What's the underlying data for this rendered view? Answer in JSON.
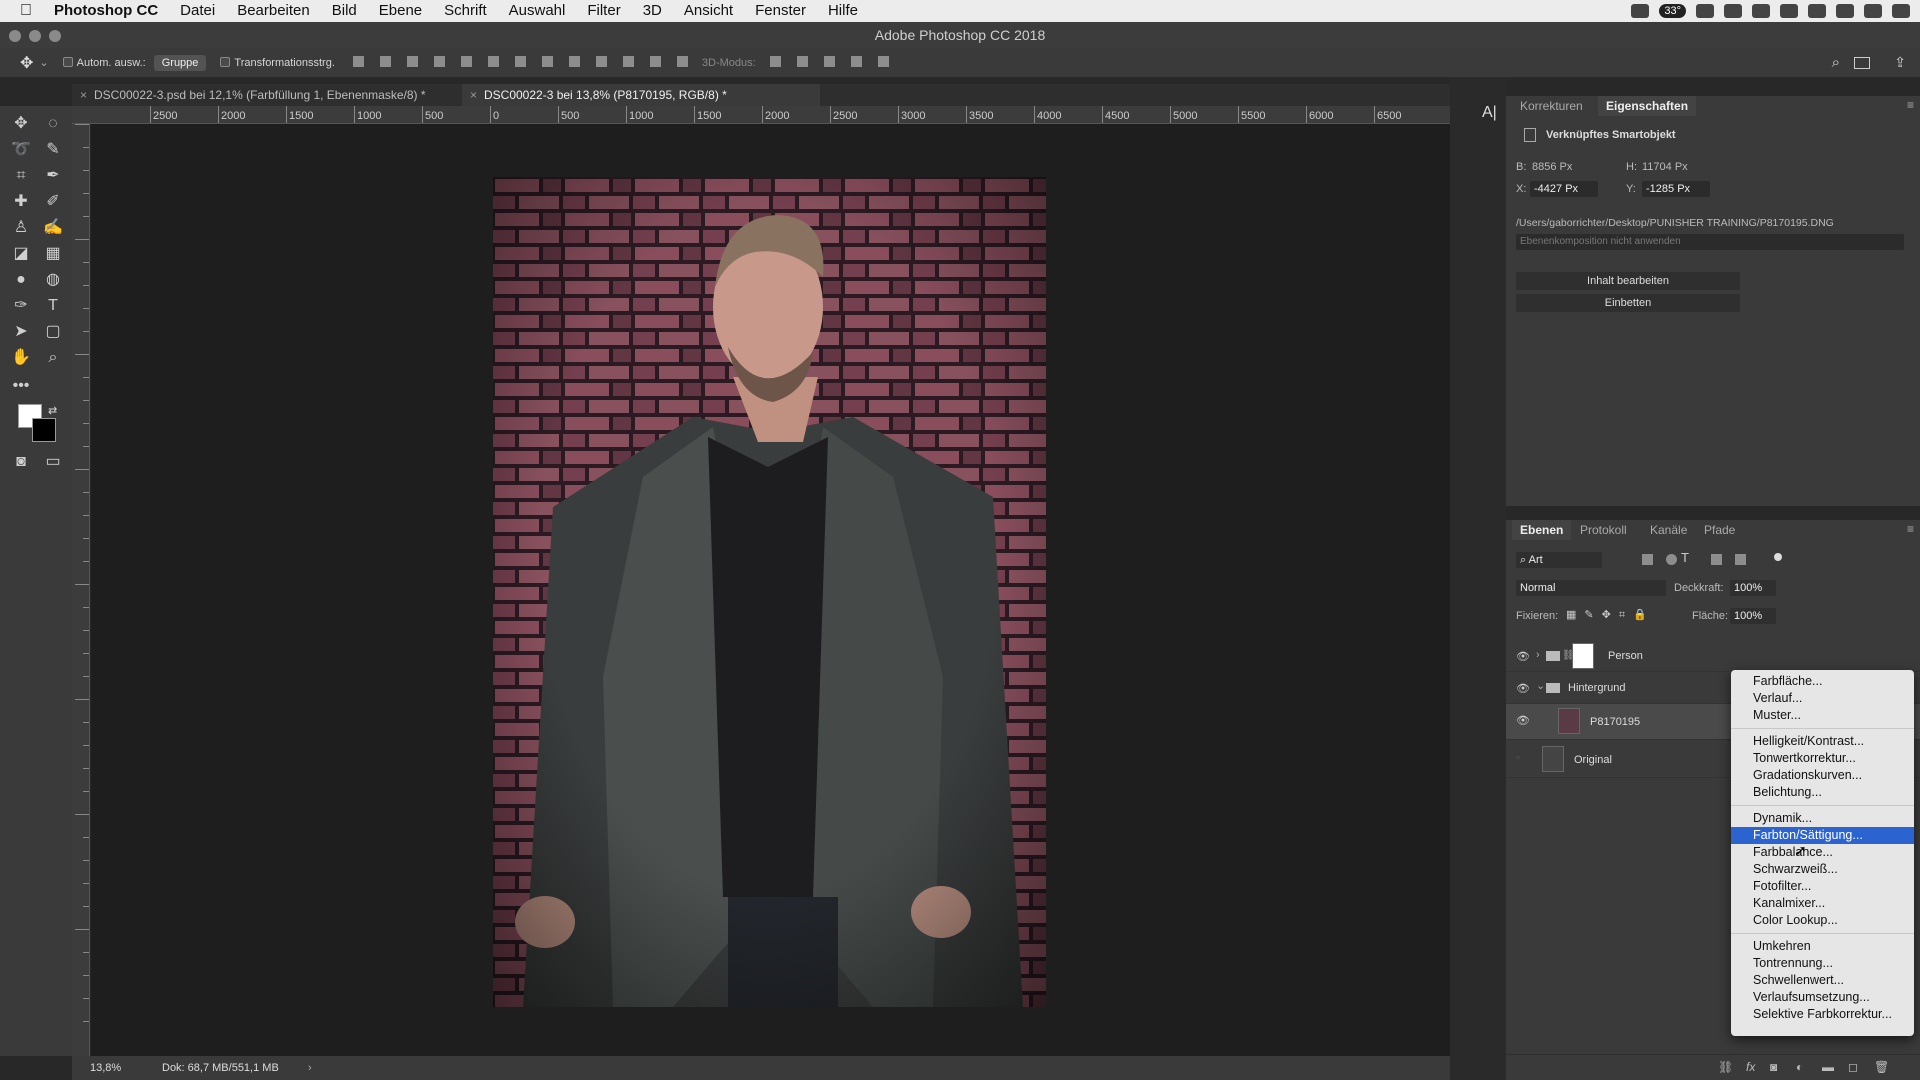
{
  "menubar": {
    "app": "Photoshop CC",
    "items": [
      "Datei",
      "Bearbeiten",
      "Bild",
      "Ebene",
      "Schrift",
      "Auswahl",
      "Filter",
      "3D",
      "Ansicht",
      "Fenster",
      "Hilfe"
    ],
    "battery": "33°"
  },
  "window_title": "Adobe Photoshop CC 2018",
  "options": {
    "auto_select": "Autom. ausw.:",
    "auto_select_value": "Gruppe",
    "transform": "Transformationsstrg.",
    "mode3d": "3D-Modus:"
  },
  "tabs": [
    {
      "label": "DSC00022-3.psd bei 12,1% (Farbfüllung 1, Ebenenmaske/8) *"
    },
    {
      "label": "DSC00022-3 bei 13,8% (P8170195, RGB/8) *"
    }
  ],
  "ruler_ticks": [
    "2500",
    "2000",
    "1500",
    "1000",
    "500",
    "0",
    "500",
    "1000",
    "1500",
    "2000",
    "2500",
    "3000",
    "3500",
    "4000",
    "4500",
    "5000",
    "5500",
    "6000",
    "6500"
  ],
  "status": {
    "zoom": "13,8%",
    "doc": "Dok: 68,7 MB/551,1 MB"
  },
  "properties": {
    "tabs": [
      "Korrekturen",
      "Eigenschaften"
    ],
    "type": "Verknüpftes Smartobjekt",
    "w_label": "B:",
    "w": "8856 Px",
    "h_label": "H:",
    "h": "11704 Px",
    "x_label": "X:",
    "x": "-4427 Px",
    "y_label": "Y:",
    "y": "-1285 Px",
    "path": "/Users/gaborrichter/Desktop/PUNISHER TRAINING/P8170195.DNG",
    "comp_placeholder": "Ebenenkomposition nicht anwenden",
    "edit_button": "Inhalt bearbeiten",
    "embed_button": "Einbetten"
  },
  "layers": {
    "tabs": [
      "Ebenen",
      "Protokoll",
      "Kanäle",
      "Pfade"
    ],
    "filter": "Art",
    "blend": "Normal",
    "opacity_label": "Deckkraft:",
    "opacity": "100%",
    "lock_label": "Fixieren:",
    "fill_label": "Fläche:",
    "fill": "100%",
    "items": [
      {
        "name": "Person"
      },
      {
        "name": "Hintergrund"
      },
      {
        "name": "P8170195"
      },
      {
        "name": "Original"
      }
    ]
  },
  "adjust_menu": {
    "items": [
      "Farbfläche...",
      "Verlauf...",
      "Muster...",
      "Helligkeit/Kontrast...",
      "Tonwertkorrektur...",
      "Gradationskurven...",
      "Belichtung...",
      "Dynamik...",
      "Farbton/Sättigung...",
      "Farbbalance...",
      "Schwarzweiß...",
      "Fotofilter...",
      "Kanalmixer...",
      "Color Lookup...",
      "Umkehren",
      "Tontrennung...",
      "Schwellenwert...",
      "Verlaufsumsetzung...",
      "Selektive Farbkorrektur..."
    ],
    "selected": "Farbton/Sättigung..."
  }
}
